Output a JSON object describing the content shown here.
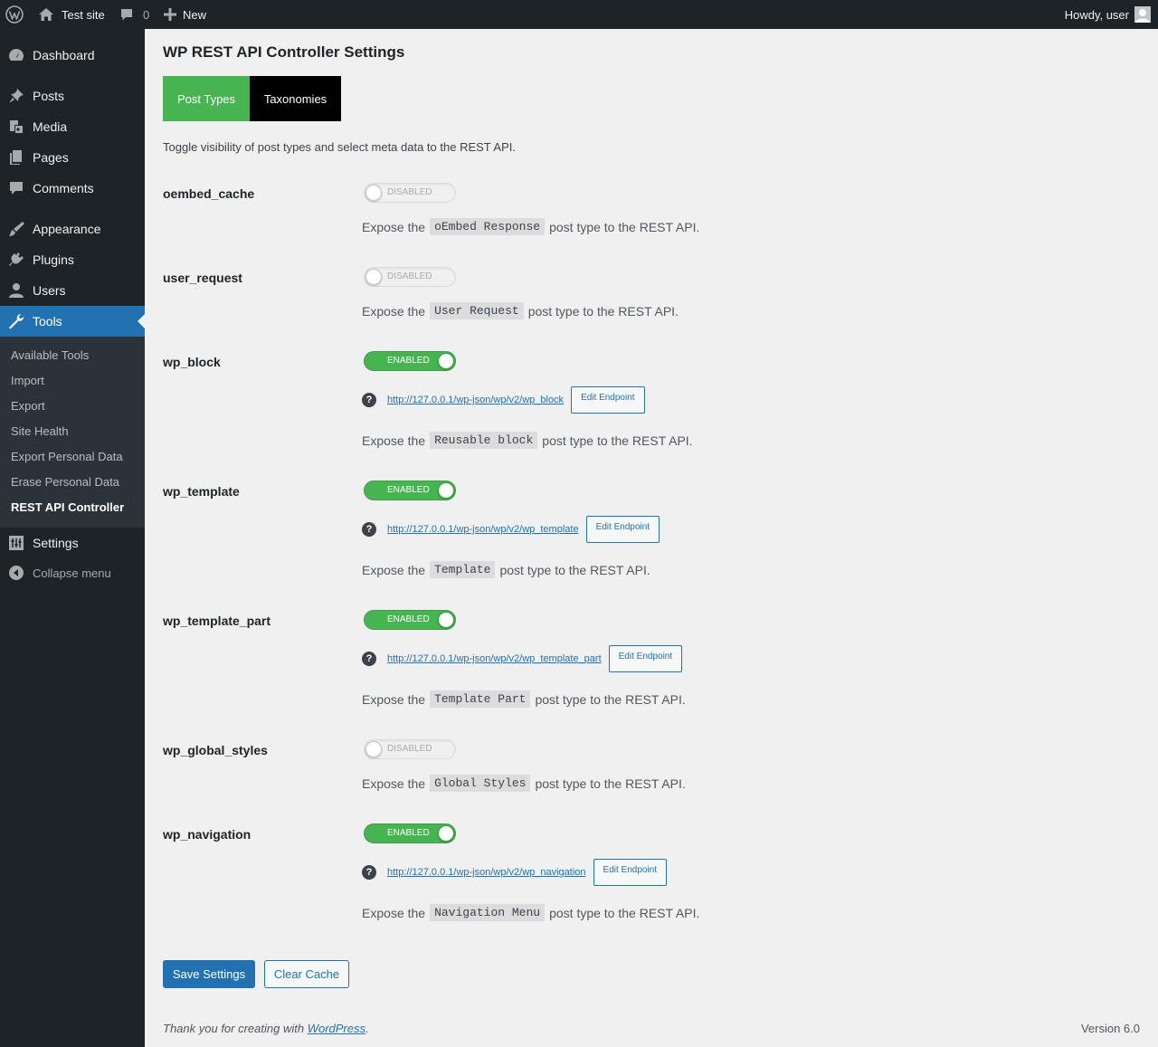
{
  "adminbar": {
    "site_name": "Test site",
    "comments_count": "0",
    "new_label": "New",
    "howdy": "Howdy, user"
  },
  "sidebar": {
    "items": [
      {
        "label": "Dashboard",
        "icon": "dashboard-icon"
      },
      {
        "label": "Posts",
        "icon": "pushpin-icon"
      },
      {
        "label": "Media",
        "icon": "media-icon"
      },
      {
        "label": "Pages",
        "icon": "pages-icon"
      },
      {
        "label": "Comments",
        "icon": "comment-icon"
      },
      {
        "label": "Appearance",
        "icon": "paintbrush-icon"
      },
      {
        "label": "Plugins",
        "icon": "plugin-icon"
      },
      {
        "label": "Users",
        "icon": "user-icon"
      },
      {
        "label": "Tools",
        "icon": "wrench-icon",
        "current": true
      },
      {
        "label": "Settings",
        "icon": "settings-icon"
      }
    ],
    "submenu": [
      "Available Tools",
      "Import",
      "Export",
      "Site Health",
      "Export Personal Data",
      "Erase Personal Data",
      "REST API Controller"
    ],
    "collapse_label": "Collapse menu"
  },
  "page": {
    "title": "WP REST API Controller Settings",
    "tabs": [
      "Post Types",
      "Taxonomies"
    ],
    "intro": "Toggle visibility of post types and select meta data to the REST API.",
    "expose_prefix": "Expose the",
    "expose_suffix": "post type to the REST API.",
    "edit_endpoint_label": "Edit Endpoint",
    "help_glyph": "?",
    "post_types": [
      {
        "slug": "oembed_cache",
        "status": "DISABLED",
        "enabled": false,
        "display_name": "oEmbed Response",
        "endpoint": ""
      },
      {
        "slug": "user_request",
        "status": "DISABLED",
        "enabled": false,
        "display_name": "User Request",
        "endpoint": ""
      },
      {
        "slug": "wp_block",
        "status": "ENABLED",
        "enabled": true,
        "display_name": "Reusable block",
        "endpoint": "http://127.0.0.1/wp-json/wp/v2/wp_block"
      },
      {
        "slug": "wp_template",
        "status": "ENABLED",
        "enabled": true,
        "display_name": "Template",
        "endpoint": "http://127.0.0.1/wp-json/wp/v2/wp_template"
      },
      {
        "slug": "wp_template_part",
        "status": "ENABLED",
        "enabled": true,
        "display_name": "Template Part",
        "endpoint": "http://127.0.0.1/wp-json/wp/v2/wp_template_part"
      },
      {
        "slug": "wp_global_styles",
        "status": "DISABLED",
        "enabled": false,
        "display_name": "Global Styles",
        "endpoint": ""
      },
      {
        "slug": "wp_navigation",
        "status": "ENABLED",
        "enabled": true,
        "display_name": "Navigation Menu",
        "endpoint": "http://127.0.0.1/wp-json/wp/v2/wp_navigation"
      }
    ],
    "save_label": "Save Settings",
    "clear_cache_label": "Clear Cache"
  },
  "footer": {
    "thanks_prefix": "Thank you for creating with",
    "thanks_link": "WordPress",
    "thanks_suffix": ".",
    "version": "Version 6.0"
  },
  "colors": {
    "adminbar_bg": "#1d2327",
    "accent": "#2271b1",
    "enabled_green": "#46b450",
    "tab_inactive": "#000000"
  }
}
